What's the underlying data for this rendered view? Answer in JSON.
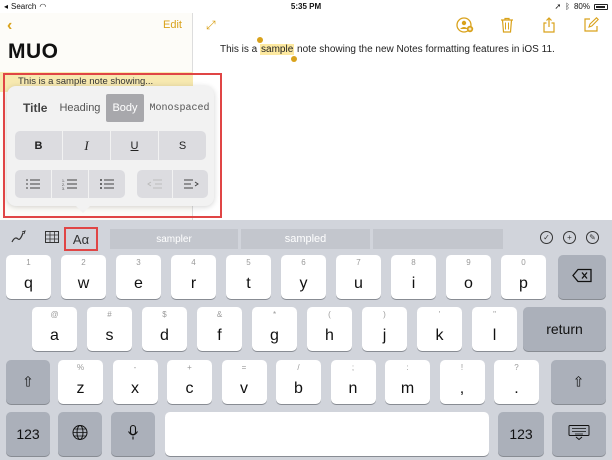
{
  "status": {
    "carrier": "Search",
    "time": "5:35 PM",
    "battery": "80%"
  },
  "list_pane": {
    "back_icon": "chevron-left-icon",
    "edit_label": "Edit",
    "folder_title": "MUO",
    "row_text": "This is a sample note showing..."
  },
  "note": {
    "text_before": "This is a ",
    "text_selected": "sample",
    "text_after": " note showing the new Notes formatting features in iOS 11.",
    "accent_color": "#d9a21b",
    "selection_color": "#fde9a0"
  },
  "toolbar_icons": [
    "add-person-icon",
    "trash-icon",
    "share-icon",
    "compose-icon"
  ],
  "format_popover": {
    "styles": [
      "Title",
      "Heading",
      "Body",
      "Monospaced"
    ],
    "active_style": "Body",
    "text_formats": [
      "B",
      "I",
      "U",
      "S"
    ],
    "list_formats": [
      "dashed-list-icon",
      "numbered-list-icon",
      "bulleted-list-icon"
    ],
    "indent": [
      "outdent-icon",
      "indent-icon"
    ]
  },
  "highlight_color": "#e04545",
  "keyboard": {
    "aa_label": "Aα",
    "suggestions": [
      "sampler",
      "sampled",
      ""
    ],
    "row1": [
      {
        "alt": "1",
        "key": "q"
      },
      {
        "alt": "2",
        "key": "w"
      },
      {
        "alt": "3",
        "key": "e"
      },
      {
        "alt": "4",
        "key": "r"
      },
      {
        "alt": "5",
        "key": "t"
      },
      {
        "alt": "6",
        "key": "y"
      },
      {
        "alt": "7",
        "key": "u"
      },
      {
        "alt": "8",
        "key": "i"
      },
      {
        "alt": "9",
        "key": "o"
      },
      {
        "alt": "0",
        "key": "p"
      }
    ],
    "row2": [
      {
        "alt": "@",
        "key": "a"
      },
      {
        "alt": "#",
        "key": "s"
      },
      {
        "alt": "$",
        "key": "d"
      },
      {
        "alt": "&",
        "key": "f"
      },
      {
        "alt": "*",
        "key": "g"
      },
      {
        "alt": "(",
        "key": "h"
      },
      {
        "alt": ")",
        "key": "j"
      },
      {
        "alt": "'",
        "key": "k"
      },
      {
        "alt": "\"",
        "key": "l"
      }
    ],
    "row3": [
      {
        "alt": "%",
        "key": "z"
      },
      {
        "alt": "-",
        "key": "x"
      },
      {
        "alt": "+",
        "key": "c"
      },
      {
        "alt": "=",
        "key": "v"
      },
      {
        "alt": "/",
        "key": "b"
      },
      {
        "alt": ";",
        "key": "n"
      },
      {
        "alt": ":",
        "key": "m"
      },
      {
        "alt": "!",
        "key": ","
      },
      {
        "alt": "?",
        "key": "."
      }
    ],
    "return_label": "return",
    "numbers_label": "123"
  }
}
